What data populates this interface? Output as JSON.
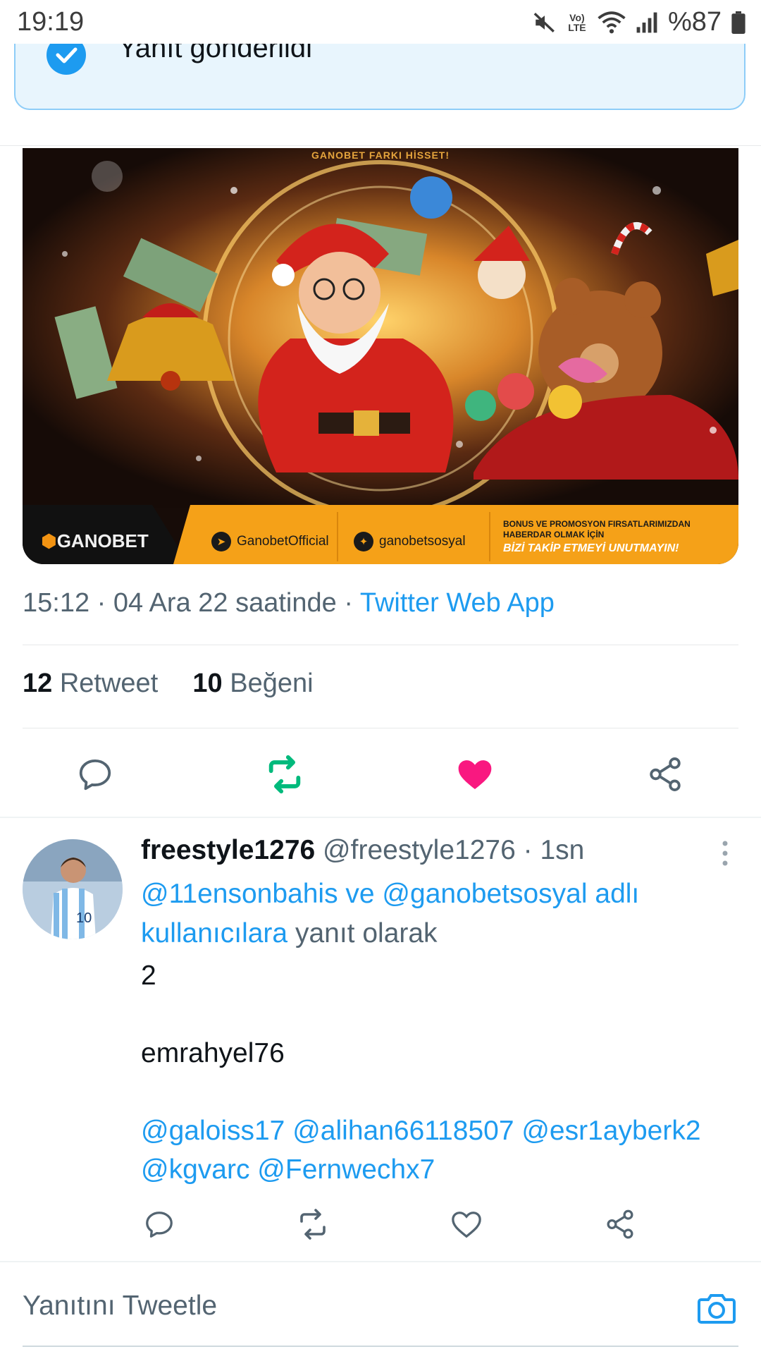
{
  "status_bar": {
    "time": "19:19",
    "network_label": "Vo) LTE",
    "battery": "%87"
  },
  "toast": {
    "text": "Yanıt gönderildi"
  },
  "promo_image": {
    "tagline": "GANOBET FARKI HİSSET!",
    "brand": "GANOBET",
    "telegram": "GanobetOfficial",
    "twitter": "ganobetsosyal",
    "promo_line1": "BONUS VE PROMOSYON FIRSATLARIMIZDAN",
    "promo_line2": "HABERDAR OLMAK İÇİN",
    "cta": "BİZİ TAKİP ETMEYİ UNUTMAYIN!"
  },
  "tweet": {
    "timestamp": "15:12 · 04 Ara 22 saatinde · ",
    "source": "Twitter Web App",
    "retweets_count": "12",
    "retweets_label": "Retweet",
    "likes_count": "10",
    "likes_label": "Beğeni",
    "liked": true
  },
  "reply": {
    "display_name": "freestyle1276",
    "handle_time": "@freestyle1276 · 1sn",
    "context_mentions": "@11ensonbahis ve @ganobetsosyal adlı kullanıcılara",
    "context_suffix": "yanıt olarak",
    "line1": "2",
    "line2": "emrahyel76",
    "mentions": "@galoiss17 @alihan66118507 @esr1ayberk2 @kgvarc @Fernwechx7"
  },
  "composer": {
    "placeholder": "Yanıtını Tweetle"
  },
  "colors": {
    "accent": "#1d9bf0",
    "retweet": "#00ba7c",
    "like": "#f91880",
    "muted": "#536471"
  },
  "icons": [
    "check-icon",
    "mute-icon",
    "wifi-icon",
    "signal-icon",
    "battery-icon",
    "reply-icon",
    "retweet-icon",
    "like-icon",
    "share-icon",
    "more-icon",
    "camera-icon"
  ]
}
